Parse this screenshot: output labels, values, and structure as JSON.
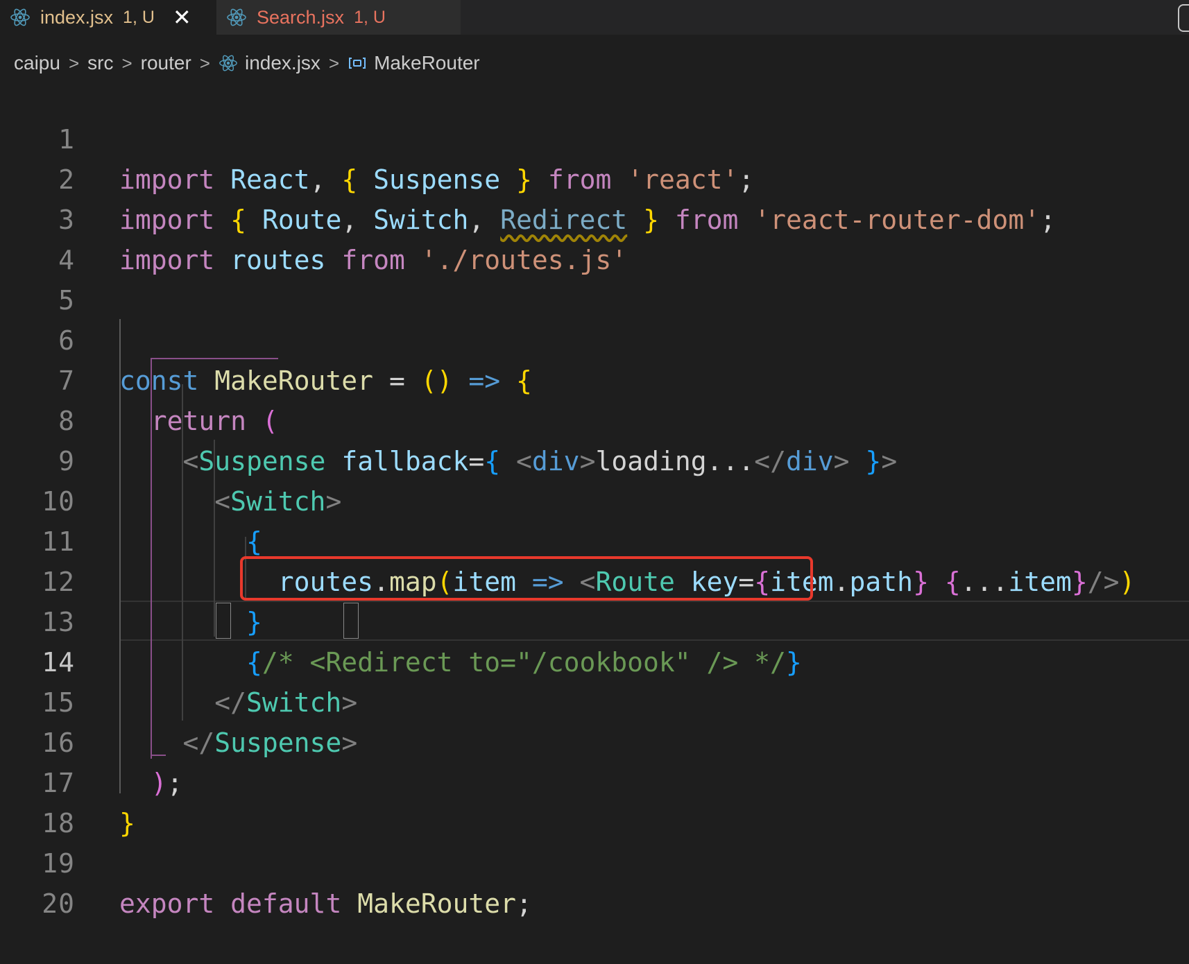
{
  "tabs": [
    {
      "name": "index.jsx",
      "status": "1, U",
      "close": "✕"
    },
    {
      "name": "Search.jsx",
      "status": "1, U"
    }
  ],
  "breadcrumb": {
    "items": [
      "caipu",
      "src",
      "router",
      "index.jsx",
      "MakeRouter"
    ],
    "separator": ">"
  },
  "editor": {
    "active_line": 14,
    "line_numbers": [
      "1",
      "2",
      "3",
      "4",
      "5",
      "6",
      "7",
      "8",
      "9",
      "10",
      "11",
      "12",
      "13",
      "14",
      "15",
      "16",
      "17",
      "18",
      "19",
      "20"
    ],
    "code": {
      "l1": [
        "import",
        " ",
        "React",
        ", ",
        "{",
        " ",
        "Suspense",
        " ",
        "}",
        " ",
        "from",
        " ",
        "'react'",
        ";"
      ],
      "l2": [
        "import",
        " ",
        "{",
        " ",
        "Route",
        ", ",
        "Switch",
        ", ",
        "Redirect",
        " ",
        "}",
        " ",
        "from",
        " ",
        "'react-router-dom'",
        ";"
      ],
      "l3": [
        "import",
        " ",
        "routes",
        " ",
        "from",
        " ",
        "'./routes.js'"
      ],
      "l6": [
        "const",
        " ",
        "MakeRouter",
        " = ",
        "(",
        ")",
        " ",
        "=>",
        " ",
        "{"
      ],
      "l7": [
        "  ",
        "return",
        " ",
        "("
      ],
      "l8": [
        "    ",
        "<",
        "Suspense",
        " ",
        "fallback",
        "=",
        "{",
        " ",
        "<",
        "div",
        ">",
        "loading...",
        "</",
        "div",
        ">",
        " ",
        "}",
        ">"
      ],
      "l9": [
        "      ",
        "<",
        "Switch",
        ">"
      ],
      "l10": [
        "        ",
        "{"
      ],
      "l11": [
        "          ",
        "routes",
        ".",
        "map",
        "(",
        "item",
        " ",
        "=>",
        " ",
        "<",
        "Route",
        " ",
        "key",
        "=",
        "{",
        "item",
        ".",
        "path",
        "}",
        " ",
        "{",
        "...",
        "item",
        "}",
        "/>",
        ")"
      ],
      "l12": [
        "        ",
        "}"
      ],
      "l13": [
        "        ",
        "{",
        "/* <Redirect to=\"/cookbook\" /> */",
        "}"
      ],
      "l14": [
        "      ",
        "</",
        "Switch",
        ">"
      ],
      "l15": [
        "    ",
        "</",
        "Suspense",
        ">"
      ],
      "l16": [
        "  ",
        ")",
        ";"
      ],
      "l17": [
        "}"
      ],
      "l19": [
        "export",
        " ",
        "default",
        " ",
        "MakeRouter",
        ";"
      ]
    }
  },
  "colors": {
    "background": "#1e1e1e",
    "annotation": "#e8392c",
    "modified": "#e2c08d",
    "error_tab": "#e9735f"
  },
  "icons": {
    "tab_file": "react-icon",
    "breadcrumb_symbol": "symbol-variable-icon"
  }
}
